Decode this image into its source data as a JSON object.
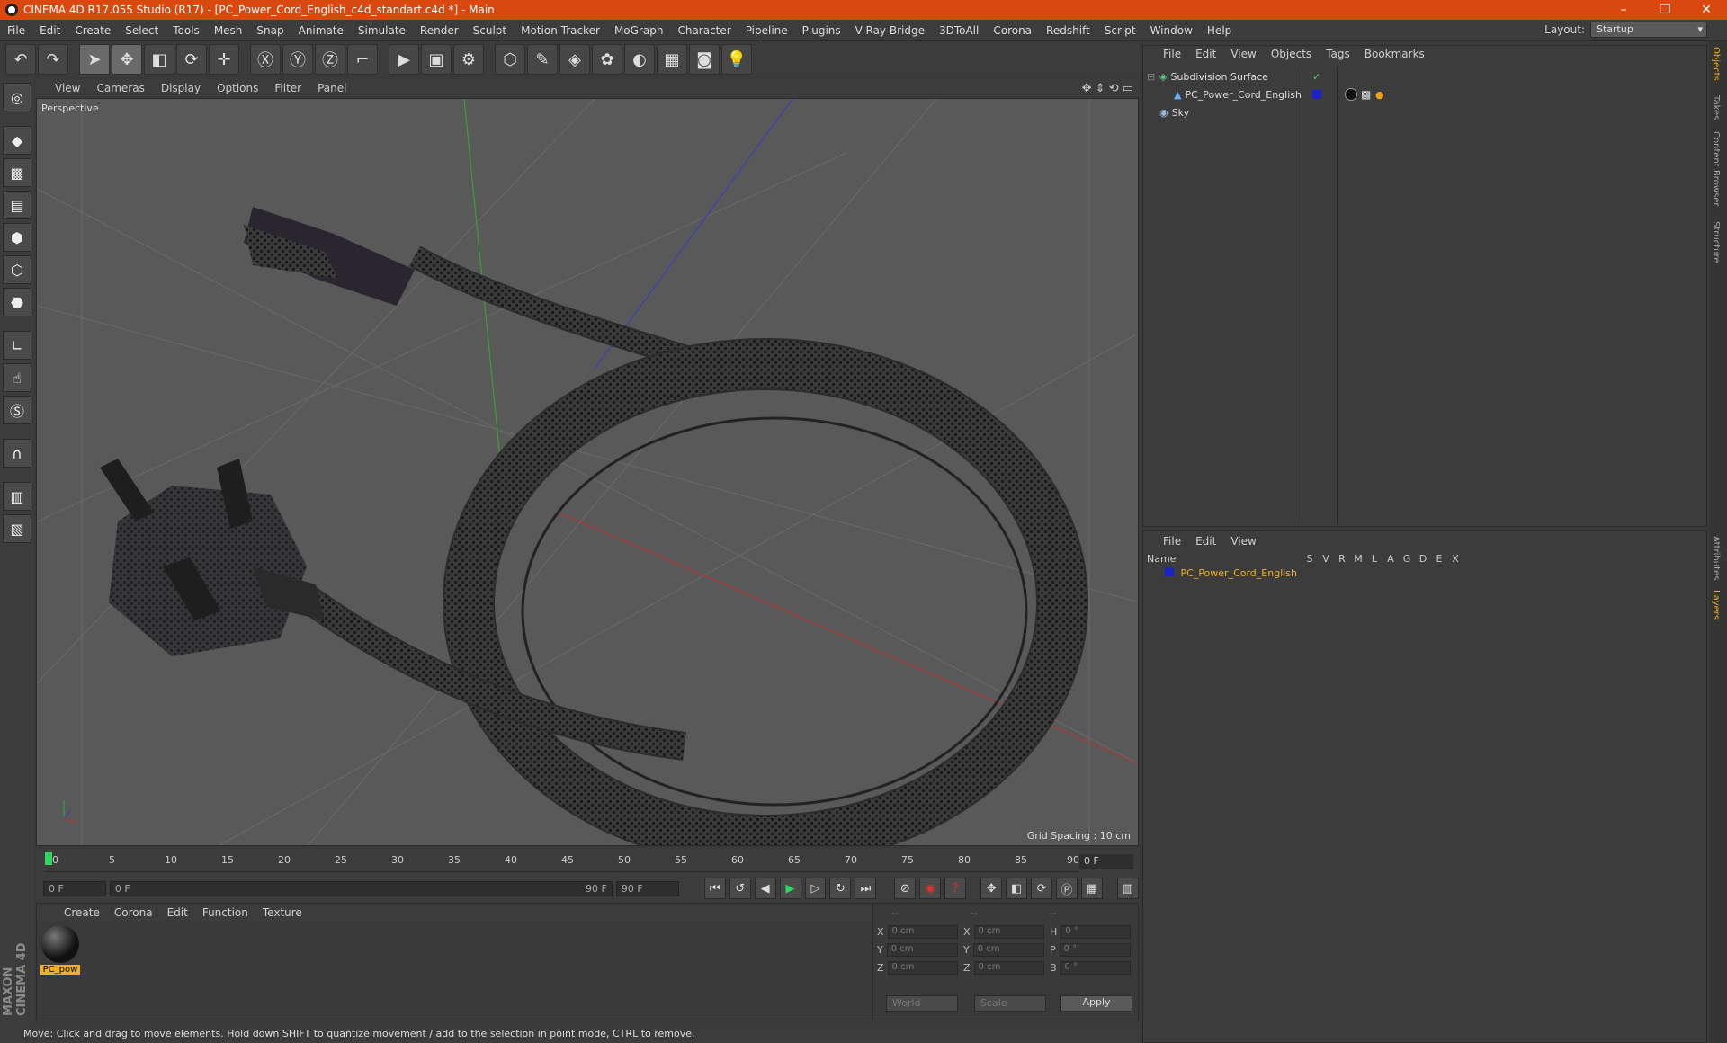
{
  "window": {
    "title": "CINEMA 4D R17.055 Studio (R17) - [PC_Power_Cord_English_c4d_standart.c4d *] - Main",
    "min": "–",
    "max": "❐",
    "close": "✕"
  },
  "menu": [
    "File",
    "Edit",
    "Create",
    "Select",
    "Tools",
    "Mesh",
    "Snap",
    "Animate",
    "Simulate",
    "Render",
    "Sculpt",
    "Motion Tracker",
    "MoGraph",
    "Character",
    "Pipeline",
    "Plugins",
    "V-Ray Bridge",
    "3DToAll",
    "Corona",
    "Redshift",
    "Script",
    "Window",
    "Help"
  ],
  "layout": {
    "label": "Layout:",
    "value": "Startup"
  },
  "viewport": {
    "menu": [
      "View",
      "Cameras",
      "Display",
      "Options",
      "Filter",
      "Panel"
    ],
    "camera_label": "Perspective",
    "grid_spacing": "Grid Spacing : 10 cm"
  },
  "timeline": {
    "ticks": [
      "0",
      "5",
      "10",
      "15",
      "20",
      "25",
      "30",
      "35",
      "40",
      "45",
      "50",
      "55",
      "60",
      "65",
      "70",
      "75",
      "80",
      "85",
      "90"
    ],
    "current_frame": "0 F",
    "start": "0 F",
    "range_start": "0 F",
    "range_end": "90 F",
    "end": "90 F"
  },
  "material_manager": {
    "menu": [
      "Create",
      "Corona",
      "Edit",
      "Function",
      "Texture"
    ],
    "material_name": "PC_pow"
  },
  "coordinates": {
    "header": [
      "--",
      "--",
      "--"
    ],
    "rows": [
      {
        "a": "X",
        "av": "0 cm",
        "b": "X",
        "bv": "0 cm",
        "c": "H",
        "cv": "0 °"
      },
      {
        "a": "Y",
        "av": "0 cm",
        "b": "Y",
        "bv": "0 cm",
        "c": "P",
        "cv": "0 °"
      },
      {
        "a": "Z",
        "av": "0 cm",
        "b": "Z",
        "bv": "0 cm",
        "c": "B",
        "cv": "0 °"
      }
    ],
    "space": "World",
    "mode": "Scale",
    "apply": "Apply"
  },
  "object_manager": {
    "menu": [
      "File",
      "Edit",
      "View",
      "Objects",
      "Tags",
      "Bookmarks"
    ],
    "objects": [
      {
        "name": "Subdivision Surface",
        "indent": 0
      },
      {
        "name": "PC_Power_Cord_English",
        "indent": 1
      },
      {
        "name": "Sky",
        "indent": 0
      }
    ]
  },
  "layer_manager": {
    "menu": [
      "File",
      "Edit",
      "View"
    ],
    "columns": [
      "Name",
      "S",
      "V",
      "R",
      "M",
      "L",
      "A",
      "G",
      "D",
      "E",
      "X"
    ],
    "layer": "PC_Power_Cord_English"
  },
  "side_tabs": [
    "Objects",
    "Takes",
    "Content Browser",
    "Structure",
    "Attributes",
    "Layers"
  ],
  "status": "Move: Click and drag to move elements. Hold down SHIFT to quantize movement / add to the selection in point mode, CTRL to remove.",
  "brand": "MAXON CINEMA 4D",
  "colors": {
    "titlebar": "#d9480f",
    "accent": "#f0b020",
    "viewport_bg": "#595959"
  }
}
